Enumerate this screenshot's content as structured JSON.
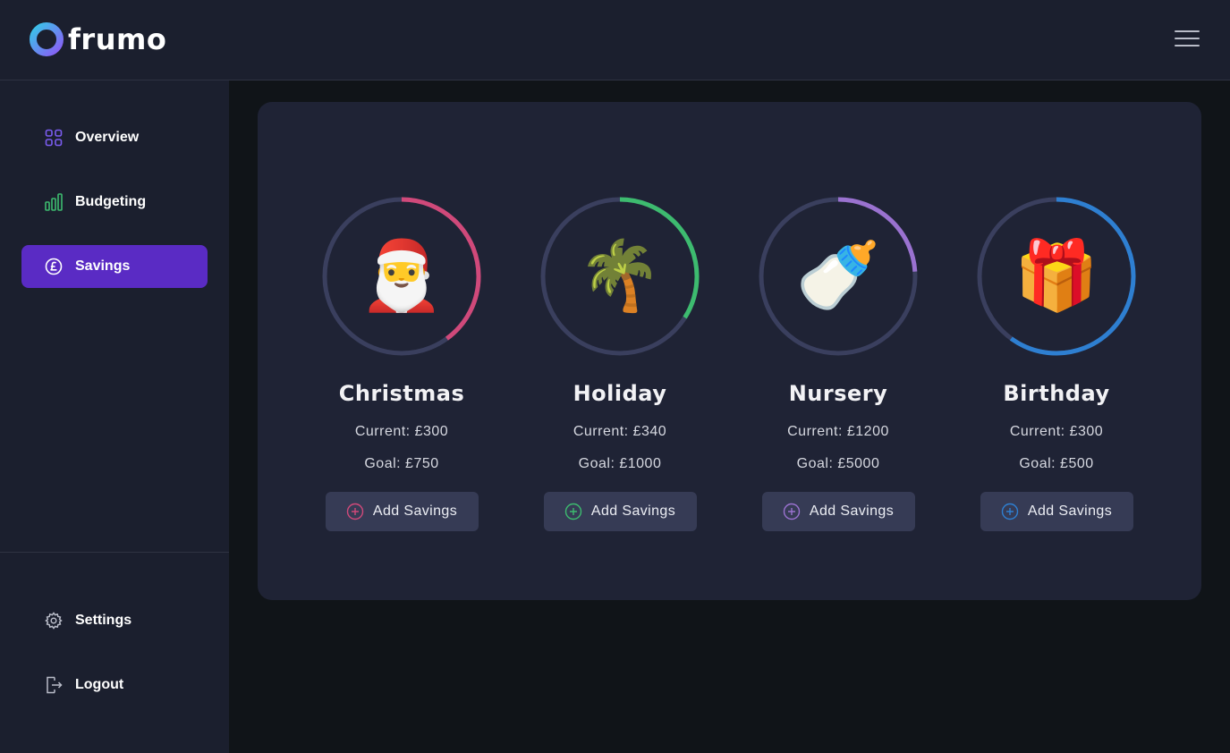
{
  "app": {
    "name": "frumo"
  },
  "header": {
    "menu_icon": "hamburger-menu-icon"
  },
  "sidebar": {
    "items": [
      {
        "label": "Overview",
        "icon": "grid-icon",
        "active": false
      },
      {
        "label": "Budgeting",
        "icon": "bar-chart-icon",
        "active": false
      },
      {
        "label": "Savings",
        "icon": "pound-coin-icon",
        "active": true
      }
    ],
    "bottom_items": [
      {
        "label": "Settings",
        "icon": "gear-icon"
      },
      {
        "label": "Logout",
        "icon": "logout-icon"
      }
    ]
  },
  "colors": {
    "accent": "#5a2bc4",
    "ring_track": "#3a3f5e",
    "christmas": "#d0497a",
    "holiday": "#3dbb6f",
    "nursery": "#9a72d0",
    "birthday": "#2e7fd1"
  },
  "goals": [
    {
      "name": "Christmas",
      "emoji": "🎅",
      "icon": "santa-hat-icon",
      "current": "Current: £300",
      "goal": "Goal: £750",
      "progress": 0.4,
      "color": "#d0497a",
      "button": "Add Savings"
    },
    {
      "name": "Holiday",
      "emoji": "🌴",
      "icon": "palm-tree-icon",
      "current": "Current: £340",
      "goal": "Goal: £1000",
      "progress": 0.34,
      "color": "#3dbb6f",
      "button": "Add Savings"
    },
    {
      "name": "Nursery",
      "emoji": "🍼",
      "icon": "baby-bottle-icon",
      "current": "Current: £1200",
      "goal": "Goal: £5000",
      "progress": 0.24,
      "color": "#9a72d0",
      "button": "Add Savings"
    },
    {
      "name": "Birthday",
      "emoji": "🎁",
      "icon": "gift-icon",
      "current": "Current: £300",
      "goal": "Goal: £500",
      "progress": 0.6,
      "color": "#2e7fd1",
      "button": "Add Savings"
    }
  ]
}
